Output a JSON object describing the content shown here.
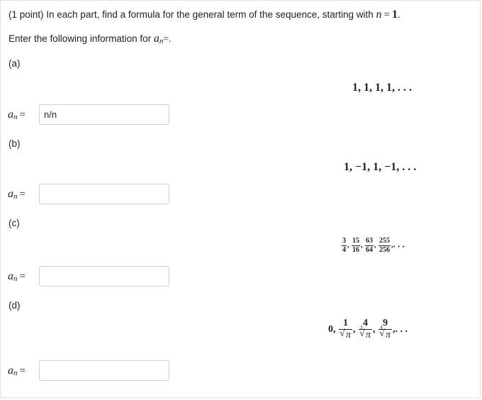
{
  "problem": {
    "intro_prefix": "(1 point) In each part, find a formula for the general term of the sequence, starting with",
    "n_var": "n",
    "eq_sign": "=",
    "start_value": "1",
    "period": ".",
    "enter_text": "Enter the following information for",
    "a_var": "a",
    "n_sub": "n",
    "enter_suffix": "=."
  },
  "parts": [
    {
      "label": "(a)",
      "sequence_text": "1, 1, 1, 1, . . .",
      "answer_label": "a",
      "answer_sub": "n",
      "answer_eq": "=",
      "answer_value": "n/n"
    },
    {
      "label": "(b)",
      "sequence_text": "1, −1, 1, −1, . . .",
      "answer_label": "a",
      "answer_sub": "n",
      "answer_eq": "=",
      "answer_value": ""
    },
    {
      "label": "(c)",
      "terms": [
        {
          "num": "3",
          "den": "4"
        },
        {
          "num": "15",
          "den": "16"
        },
        {
          "num": "63",
          "den": "64"
        },
        {
          "num": "255",
          "den": "256"
        }
      ],
      "sep": ",",
      "ellipsis": ". . .",
      "answer_label": "a",
      "answer_sub": "n",
      "answer_eq": "=",
      "answer_value": ""
    },
    {
      "label": "(d)",
      "first_term": "0",
      "terms": [
        {
          "num": "1",
          "radicand": "π",
          "index": ""
        },
        {
          "num": "4",
          "radicand": "π",
          "index": "3"
        },
        {
          "num": "9",
          "radicand": "π",
          "index": "4"
        }
      ],
      "sep": ",",
      "ellipsis": ". . .",
      "answer_label": "a",
      "answer_sub": "n",
      "answer_eq": "=",
      "answer_value": ""
    }
  ]
}
